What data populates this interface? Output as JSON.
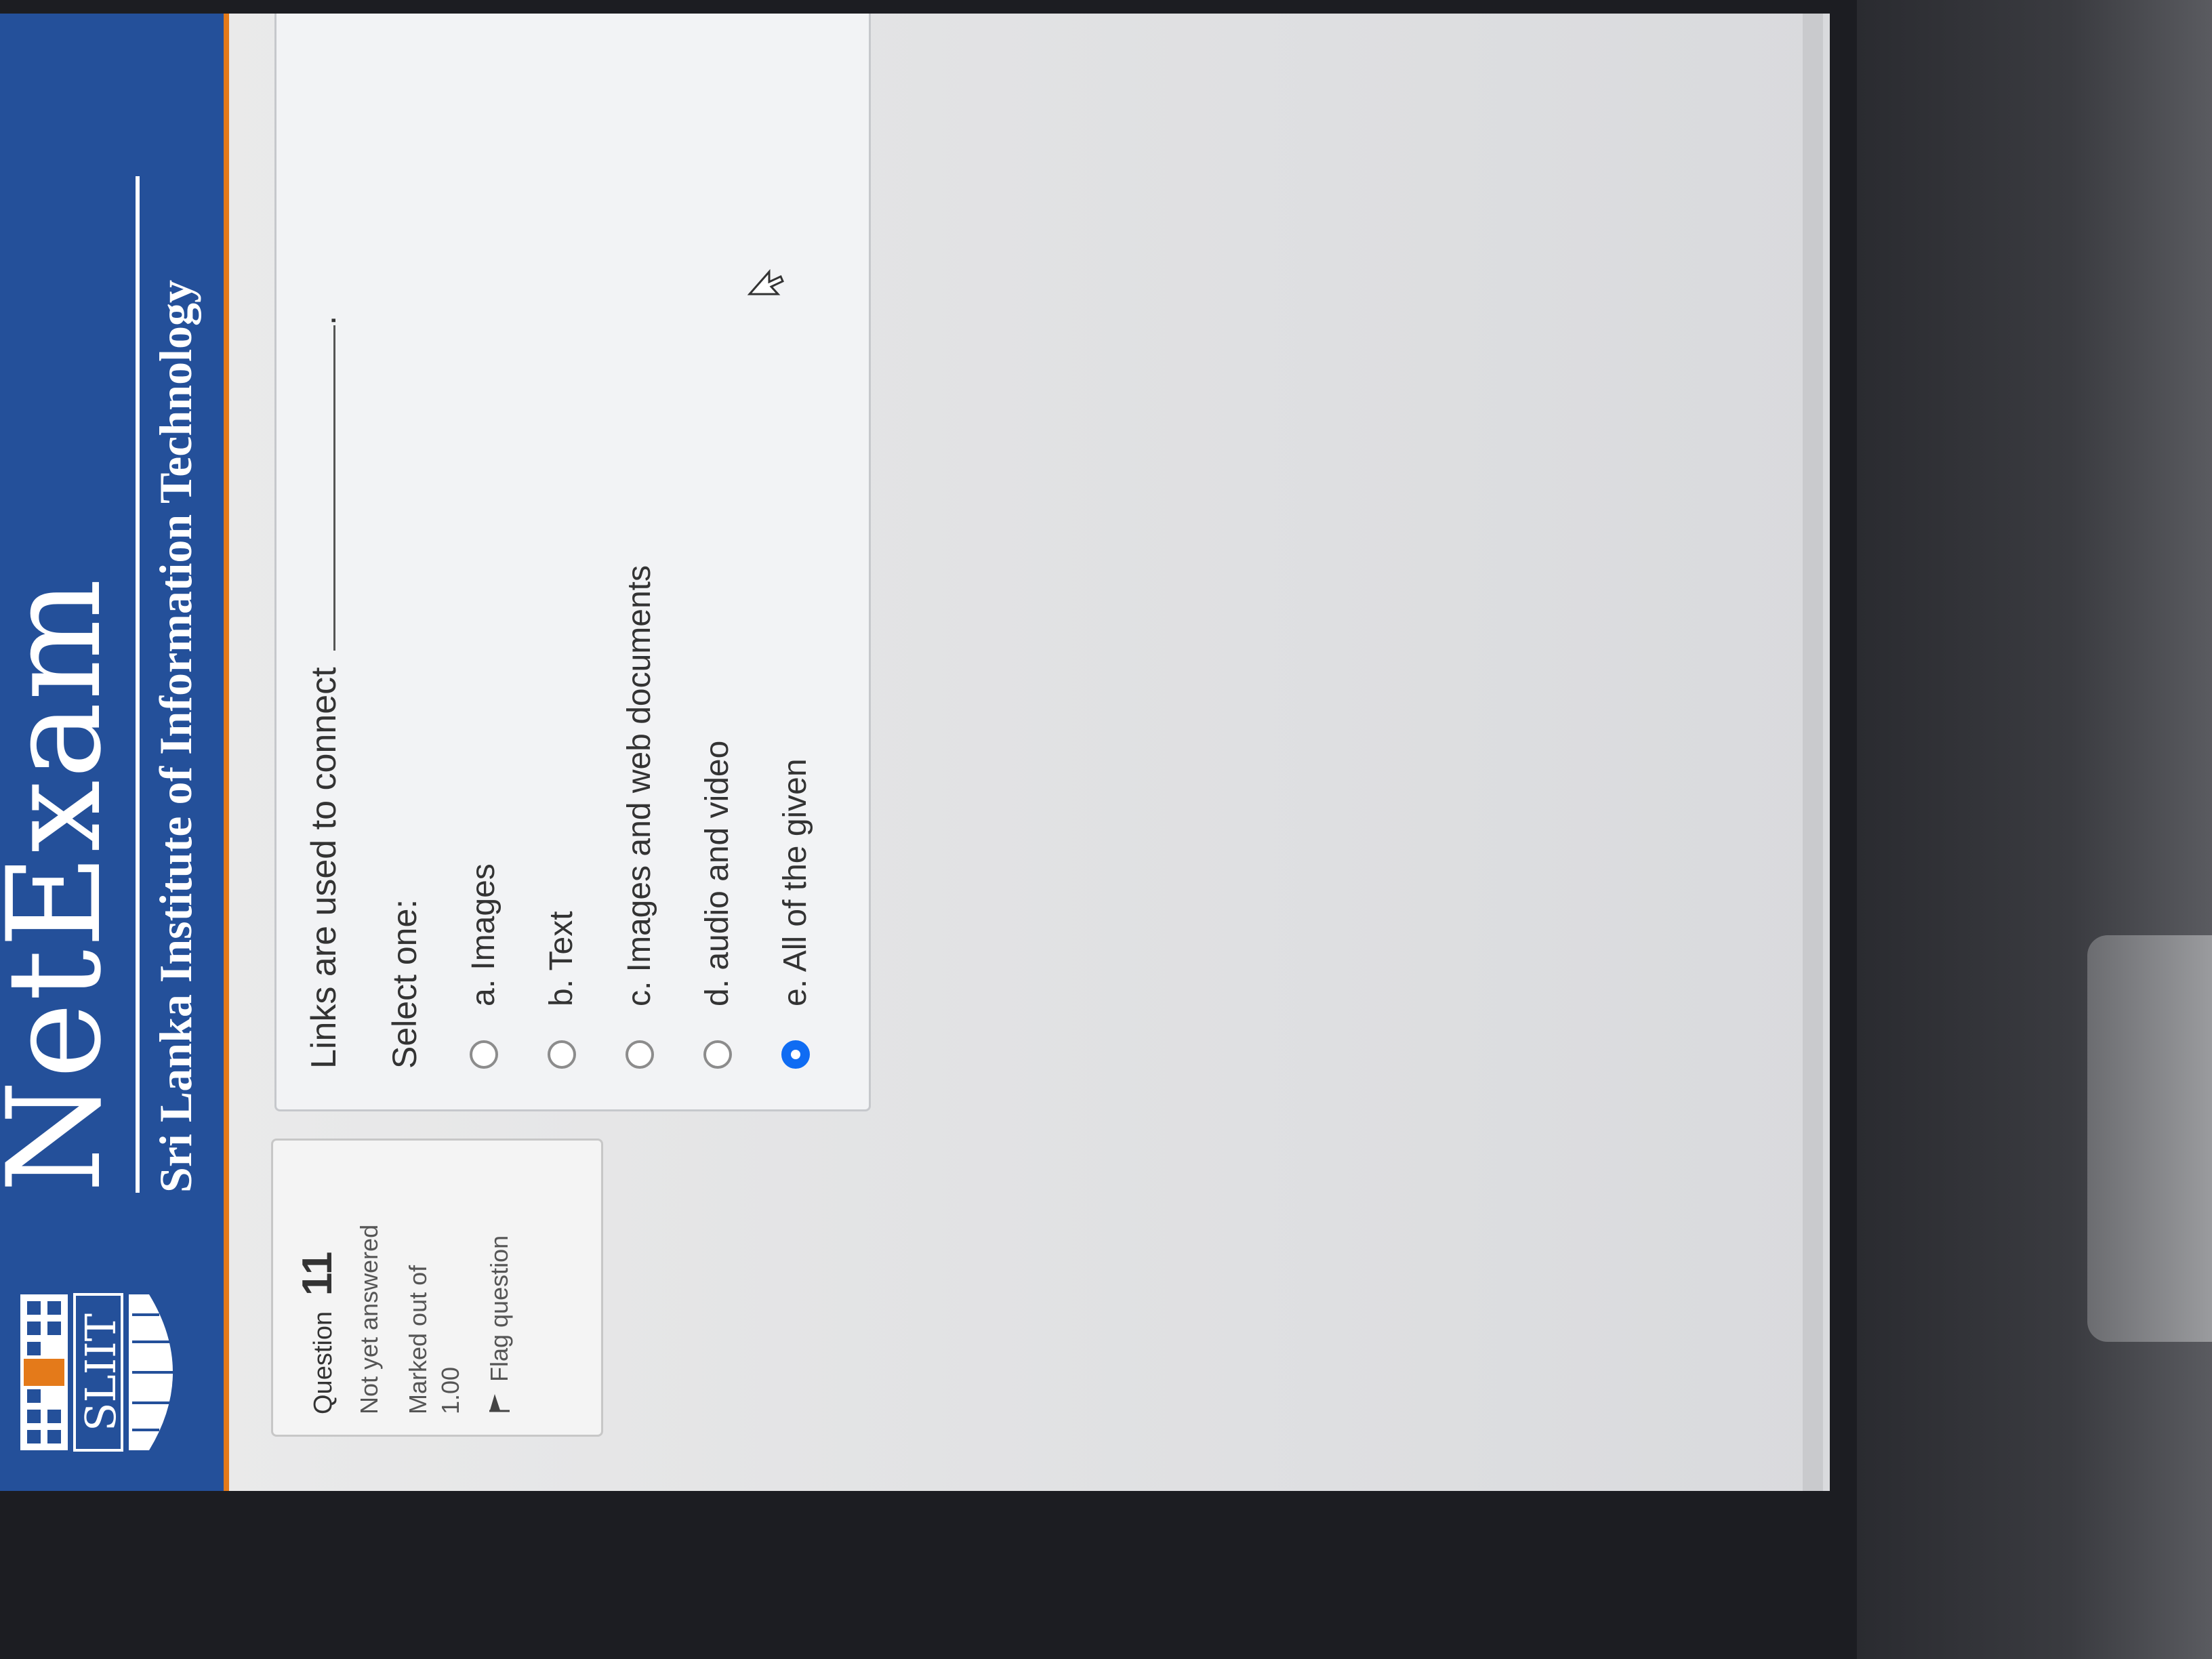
{
  "header": {
    "logo_text": "SLIIT",
    "title": "NetExam",
    "subtitle": "Sri Lanka Institute of Information Technology"
  },
  "info_card": {
    "question_word": "Question",
    "question_number": "11",
    "status": "Not yet answered",
    "marked_label": "Marked out of",
    "marked_value": "1.00",
    "flag_label": "Flag question"
  },
  "question": {
    "text": "Links are used to connect",
    "trailing_punct": ".",
    "select_label": "Select one:",
    "options": [
      {
        "label": "a. Images",
        "checked": false
      },
      {
        "label": "b. Text",
        "checked": false
      },
      {
        "label": "c. Images and web documents",
        "checked": false
      },
      {
        "label": "d. audio and video",
        "checked": false
      },
      {
        "label": "e. All of the given",
        "checked": true
      }
    ]
  },
  "colors": {
    "header_blue": "#24509a",
    "accent_orange": "#e47a1a",
    "radio_selected": "#0f6cf3"
  }
}
